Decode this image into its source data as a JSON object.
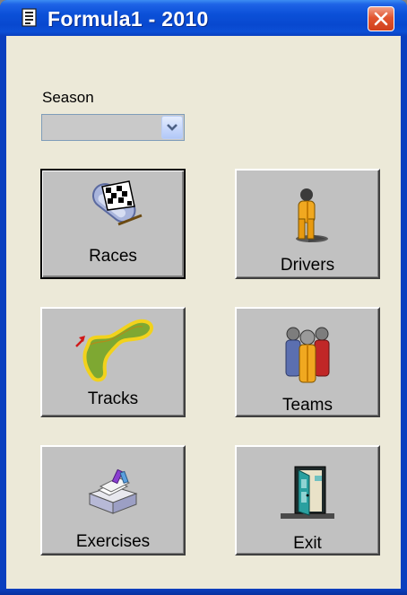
{
  "window": {
    "title": "Formula1 - 2010",
    "title_icon": "document-icon",
    "close_icon": "close-icon"
  },
  "season": {
    "label": "Season",
    "value": ""
  },
  "buttons": [
    {
      "label": "Races",
      "icon": "checkered-flag-icon",
      "focused": true
    },
    {
      "label": "Drivers",
      "icon": "driver-person-icon"
    },
    {
      "label": "Tracks",
      "icon": "track-map-icon"
    },
    {
      "label": "Teams",
      "icon": "team-people-icon"
    },
    {
      "label": "Exercises",
      "icon": "exercise-tray-icon"
    },
    {
      "label": "Exit",
      "icon": "exit-door-icon"
    }
  ],
  "colors": {
    "titlebar": "#0b50d8",
    "client_background": "#ece9d8",
    "button_face": "#c1c1c1",
    "close_button": "#e2552f"
  }
}
